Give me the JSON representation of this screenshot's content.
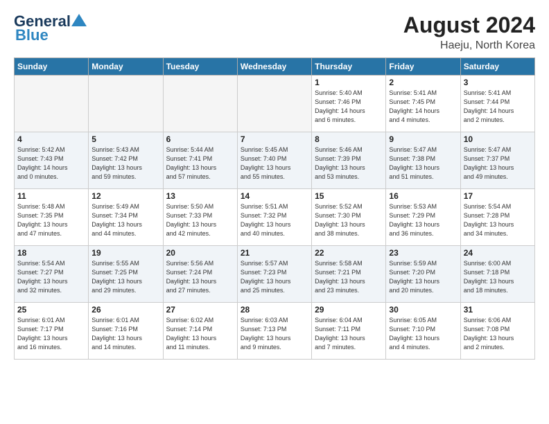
{
  "header": {
    "logo_line1": "General",
    "logo_line2": "Blue",
    "month": "August 2024",
    "location": "Haeju, North Korea"
  },
  "weekdays": [
    "Sunday",
    "Monday",
    "Tuesday",
    "Wednesday",
    "Thursday",
    "Friday",
    "Saturday"
  ],
  "weeks": [
    [
      {
        "day": "",
        "info": ""
      },
      {
        "day": "",
        "info": ""
      },
      {
        "day": "",
        "info": ""
      },
      {
        "day": "",
        "info": ""
      },
      {
        "day": "1",
        "info": "Sunrise: 5:40 AM\nSunset: 7:46 PM\nDaylight: 14 hours\nand 6 minutes."
      },
      {
        "day": "2",
        "info": "Sunrise: 5:41 AM\nSunset: 7:45 PM\nDaylight: 14 hours\nand 4 minutes."
      },
      {
        "day": "3",
        "info": "Sunrise: 5:41 AM\nSunset: 7:44 PM\nDaylight: 14 hours\nand 2 minutes."
      }
    ],
    [
      {
        "day": "4",
        "info": "Sunrise: 5:42 AM\nSunset: 7:43 PM\nDaylight: 14 hours\nand 0 minutes."
      },
      {
        "day": "5",
        "info": "Sunrise: 5:43 AM\nSunset: 7:42 PM\nDaylight: 13 hours\nand 59 minutes."
      },
      {
        "day": "6",
        "info": "Sunrise: 5:44 AM\nSunset: 7:41 PM\nDaylight: 13 hours\nand 57 minutes."
      },
      {
        "day": "7",
        "info": "Sunrise: 5:45 AM\nSunset: 7:40 PM\nDaylight: 13 hours\nand 55 minutes."
      },
      {
        "day": "8",
        "info": "Sunrise: 5:46 AM\nSunset: 7:39 PM\nDaylight: 13 hours\nand 53 minutes."
      },
      {
        "day": "9",
        "info": "Sunrise: 5:47 AM\nSunset: 7:38 PM\nDaylight: 13 hours\nand 51 minutes."
      },
      {
        "day": "10",
        "info": "Sunrise: 5:47 AM\nSunset: 7:37 PM\nDaylight: 13 hours\nand 49 minutes."
      }
    ],
    [
      {
        "day": "11",
        "info": "Sunrise: 5:48 AM\nSunset: 7:35 PM\nDaylight: 13 hours\nand 47 minutes."
      },
      {
        "day": "12",
        "info": "Sunrise: 5:49 AM\nSunset: 7:34 PM\nDaylight: 13 hours\nand 44 minutes."
      },
      {
        "day": "13",
        "info": "Sunrise: 5:50 AM\nSunset: 7:33 PM\nDaylight: 13 hours\nand 42 minutes."
      },
      {
        "day": "14",
        "info": "Sunrise: 5:51 AM\nSunset: 7:32 PM\nDaylight: 13 hours\nand 40 minutes."
      },
      {
        "day": "15",
        "info": "Sunrise: 5:52 AM\nSunset: 7:30 PM\nDaylight: 13 hours\nand 38 minutes."
      },
      {
        "day": "16",
        "info": "Sunrise: 5:53 AM\nSunset: 7:29 PM\nDaylight: 13 hours\nand 36 minutes."
      },
      {
        "day": "17",
        "info": "Sunrise: 5:54 AM\nSunset: 7:28 PM\nDaylight: 13 hours\nand 34 minutes."
      }
    ],
    [
      {
        "day": "18",
        "info": "Sunrise: 5:54 AM\nSunset: 7:27 PM\nDaylight: 13 hours\nand 32 minutes."
      },
      {
        "day": "19",
        "info": "Sunrise: 5:55 AM\nSunset: 7:25 PM\nDaylight: 13 hours\nand 29 minutes."
      },
      {
        "day": "20",
        "info": "Sunrise: 5:56 AM\nSunset: 7:24 PM\nDaylight: 13 hours\nand 27 minutes."
      },
      {
        "day": "21",
        "info": "Sunrise: 5:57 AM\nSunset: 7:23 PM\nDaylight: 13 hours\nand 25 minutes."
      },
      {
        "day": "22",
        "info": "Sunrise: 5:58 AM\nSunset: 7:21 PM\nDaylight: 13 hours\nand 23 minutes."
      },
      {
        "day": "23",
        "info": "Sunrise: 5:59 AM\nSunset: 7:20 PM\nDaylight: 13 hours\nand 20 minutes."
      },
      {
        "day": "24",
        "info": "Sunrise: 6:00 AM\nSunset: 7:18 PM\nDaylight: 13 hours\nand 18 minutes."
      }
    ],
    [
      {
        "day": "25",
        "info": "Sunrise: 6:01 AM\nSunset: 7:17 PM\nDaylight: 13 hours\nand 16 minutes."
      },
      {
        "day": "26",
        "info": "Sunrise: 6:01 AM\nSunset: 7:16 PM\nDaylight: 13 hours\nand 14 minutes."
      },
      {
        "day": "27",
        "info": "Sunrise: 6:02 AM\nSunset: 7:14 PM\nDaylight: 13 hours\nand 11 minutes."
      },
      {
        "day": "28",
        "info": "Sunrise: 6:03 AM\nSunset: 7:13 PM\nDaylight: 13 hours\nand 9 minutes."
      },
      {
        "day": "29",
        "info": "Sunrise: 6:04 AM\nSunset: 7:11 PM\nDaylight: 13 hours\nand 7 minutes."
      },
      {
        "day": "30",
        "info": "Sunrise: 6:05 AM\nSunset: 7:10 PM\nDaylight: 13 hours\nand 4 minutes."
      },
      {
        "day": "31",
        "info": "Sunrise: 6:06 AM\nSunset: 7:08 PM\nDaylight: 13 hours\nand 2 minutes."
      }
    ]
  ]
}
